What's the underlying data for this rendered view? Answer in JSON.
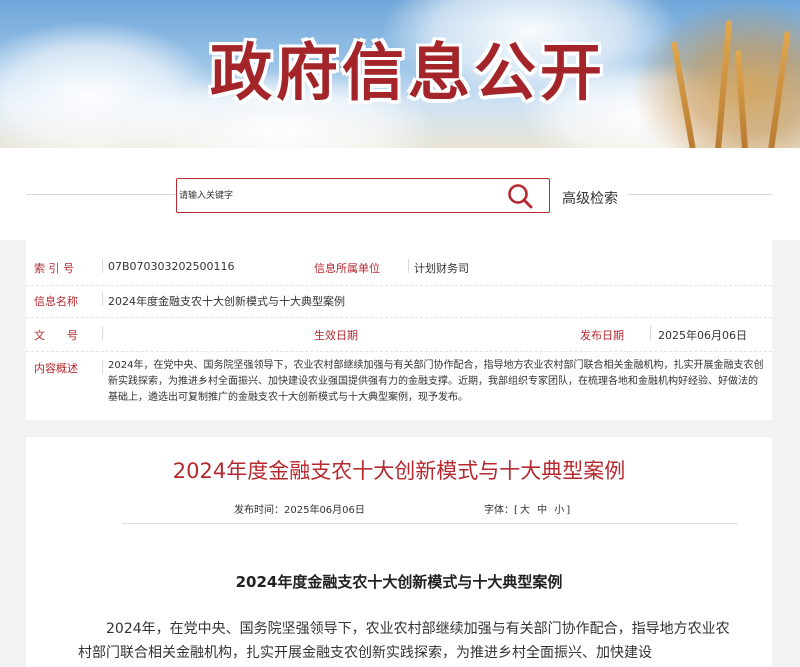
{
  "banner": {
    "title": "政府信息公开"
  },
  "search": {
    "placeholder": "请输入关键字",
    "advanced_label": "高级检索"
  },
  "meta": {
    "index_label": "索 引 号",
    "index_value": "07B070303202500116",
    "unit_label": "信息所属单位",
    "unit_value": "计划财务司",
    "name_label": "信息名称",
    "name_value": "2024年度金融支农十大创新模式与十大典型案例",
    "doc_label": "文　　号",
    "doc_value": "",
    "effective_label": "生效日期",
    "effective_value": "",
    "publish_label": "发布日期",
    "publish_value": "2025年06月06日",
    "summary_label": "内容概述",
    "summary_value": "2024年，在党中央、国务院坚强领导下，农业农村部继续加强与有关部门协作配合，指导地方农业农村部门联合相关金融机构，扎实开展金融支农创新实践探索，为推进乡村全面振兴、加快建设农业强国提供强有力的金融支撑。近期，我部组织专家团队，在梳理各地和金融机构好经验、好做法的基础上，遴选出可复制推广的金融支农十大创新模式与十大典型案例，现予发布。"
  },
  "article": {
    "title": "2024年度金融支农十大创新模式与十大典型案例",
    "publish_time_label": "发布时间：",
    "publish_time_value": "2025年06月06日",
    "font_label": "字体：",
    "font_bracket_open": "[",
    "font_large": "大",
    "font_medium": "中",
    "font_small": "小",
    "font_bracket_close": "]",
    "heading": "2024年度金融支农十大创新模式与十大典型案例",
    "body": "2024年，在党中央、国务院坚强领导下，农业农村部继续加强与有关部门协作配合，指导地方农业农村部门联合相关金融机构，扎实开展金融支农创新实践探索，为推进乡村全面振兴、加快建设"
  },
  "colors": {
    "accent": "#b5292f",
    "page_bg": "#f2f2f2"
  }
}
